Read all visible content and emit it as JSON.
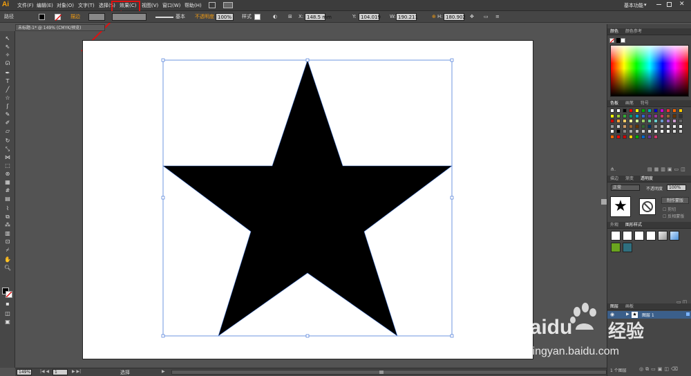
{
  "app": {
    "logo": "Ai",
    "workspace": "基本功能",
    "workspace_arrow": "▾"
  },
  "menu": [
    "文件(F)",
    "编辑(E)",
    "对象(O)",
    "文字(T)",
    "选择(S)",
    "效果(C)",
    "视图(V)",
    "窗口(W)",
    "帮助(H)"
  ],
  "control": {
    "selection_label": "路径",
    "stroke_label": "描边",
    "stroke_style": "基本",
    "opacity_label": "不透明度",
    "opacity_value": "100%",
    "style_label": "样式",
    "x_value": "148.5 mm",
    "y_value": "104.019",
    "w_value": "190.211",
    "h_value": "180.902"
  },
  "document_tab": "未标题-1* @ 149% (CMYK/预览)",
  "status": {
    "zoom": "149%",
    "page": "1",
    "tool": "选择"
  },
  "panels": {
    "color": {
      "tabs": [
        "颜色",
        "颜色参考"
      ]
    },
    "swatches": {
      "tabs": [
        "色板",
        "画笔",
        "符号"
      ]
    },
    "transparency": {
      "tabs": [
        "描边",
        "渐变",
        "透明度"
      ],
      "mode": "正常",
      "opacity_label": "不透明度",
      "opacity_value": "100%",
      "make_mask": "制作蒙版",
      "clip": "剪切",
      "invert_mask": "反相蒙版"
    },
    "graphic_styles": {
      "tabs": [
        "外观",
        "图形样式"
      ]
    },
    "layers": {
      "tabs": [
        "图层",
        "画板"
      ],
      "layer_name": "图层 1",
      "count": "1 个图层"
    }
  },
  "watermark": {
    "brand": "Baidu",
    "brand_cn": "经验",
    "url": "jingyan.baidu.com"
  },
  "colors": {
    "accent_orange": "#f39c12",
    "annotation_red": "#e01010",
    "selection_blue": "#4a7bd8"
  }
}
